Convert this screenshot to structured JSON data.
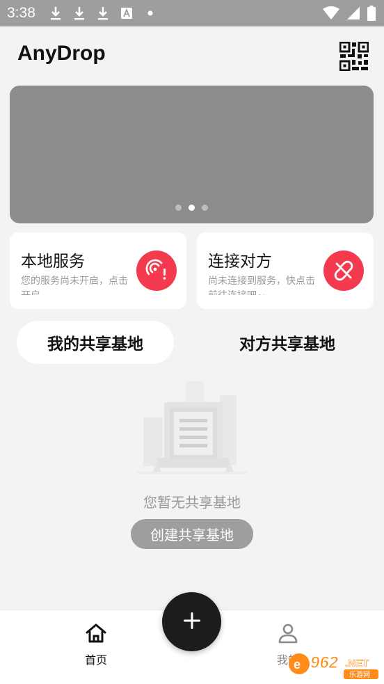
{
  "status_bar": {
    "time": "3:38",
    "icons": [
      "download-icon",
      "download-icon",
      "download-icon",
      "font-icon",
      "dot-icon",
      "wifi-icon",
      "signal-icon",
      "battery-icon"
    ]
  },
  "app_bar": {
    "title": "AnyDrop",
    "qr_icon": "qr-code-icon"
  },
  "banner": {
    "dots_count": 3,
    "active_dot": 1,
    "color": "#8c8c8c"
  },
  "cards": {
    "local": {
      "title": "本地服务",
      "description": "您的服务尚未开启，点击开启",
      "icon": "broadcast-warning-icon"
    },
    "remote": {
      "title": "连接对方",
      "description": "尚未连接到服务，快点击前往连接吧~",
      "icon": "link-broken-icon"
    },
    "accent_color": "#f43a4f"
  },
  "tabs": {
    "mine": "我的共享基地",
    "other": "对方共享基地",
    "selected": "mine"
  },
  "empty_state": {
    "message": "您暂无共享基地",
    "button_label": "创建共享基地"
  },
  "bottom_nav": {
    "home_label": "首页",
    "mine_label": "我的",
    "fab_icon": "plus-icon"
  },
  "watermark": {
    "text": "962.NET",
    "subtext": "乐游网"
  }
}
